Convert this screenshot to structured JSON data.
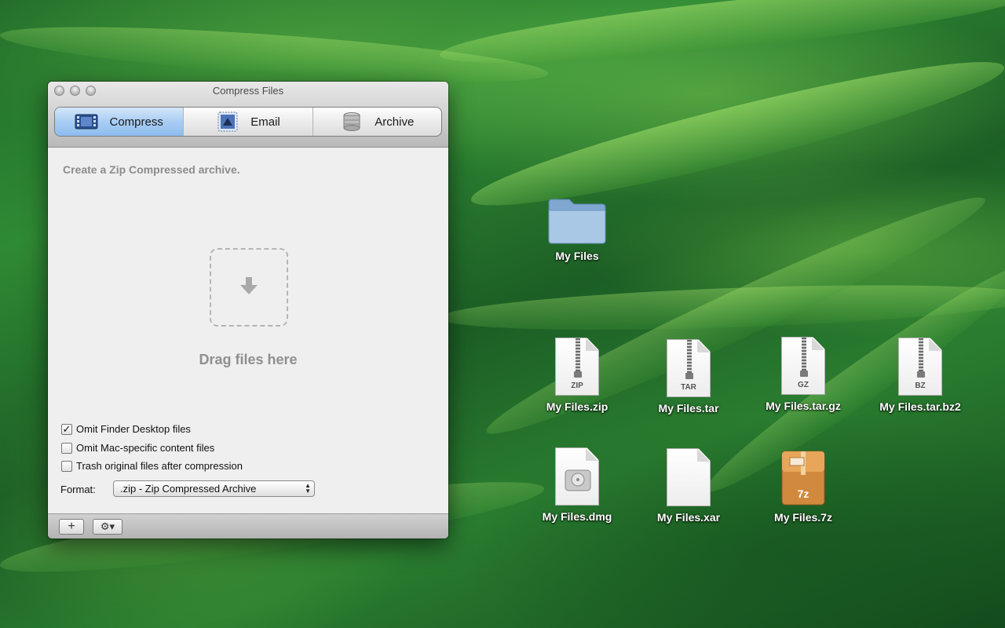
{
  "window": {
    "title": "Compress Files",
    "tabs": [
      {
        "label": "Compress",
        "icon": "film-icon",
        "active": true
      },
      {
        "label": "Email",
        "icon": "mail-stamp-icon",
        "active": false
      },
      {
        "label": "Archive",
        "icon": "database-icon",
        "active": false
      }
    ],
    "description": "Create a Zip Compressed archive.",
    "drop_text": "Drag files here",
    "options": [
      {
        "label": "Omit Finder Desktop files",
        "checked": true
      },
      {
        "label": "Omit Mac-specific content files",
        "checked": false
      },
      {
        "label": "Trash original files after compression",
        "checked": false
      }
    ],
    "format_label": "Format:",
    "format_value": ".zip - Zip Compressed Archive",
    "add_button": "+",
    "gear_button": "⚙▾"
  },
  "desktop": {
    "items": [
      {
        "label": "My Files",
        "kind": "folder"
      },
      {
        "label": "My Files.zip",
        "kind": "archive",
        "tag": "ZIP"
      },
      {
        "label": "My Files.tar",
        "kind": "archive",
        "tag": "TAR"
      },
      {
        "label": "My Files.tar.gz",
        "kind": "archive",
        "tag": "GZ"
      },
      {
        "label": "My Files.tar.bz2",
        "kind": "archive",
        "tag": "BZ"
      },
      {
        "label": "My Files.dmg",
        "kind": "disk-image"
      },
      {
        "label": "My Files.xar",
        "kind": "blank"
      },
      {
        "label": "My Files.7z",
        "kind": "box",
        "tag": "7z"
      }
    ]
  },
  "colors": {
    "active_tab": "#a9cdf3",
    "desktop_green": "#2f8a34"
  }
}
